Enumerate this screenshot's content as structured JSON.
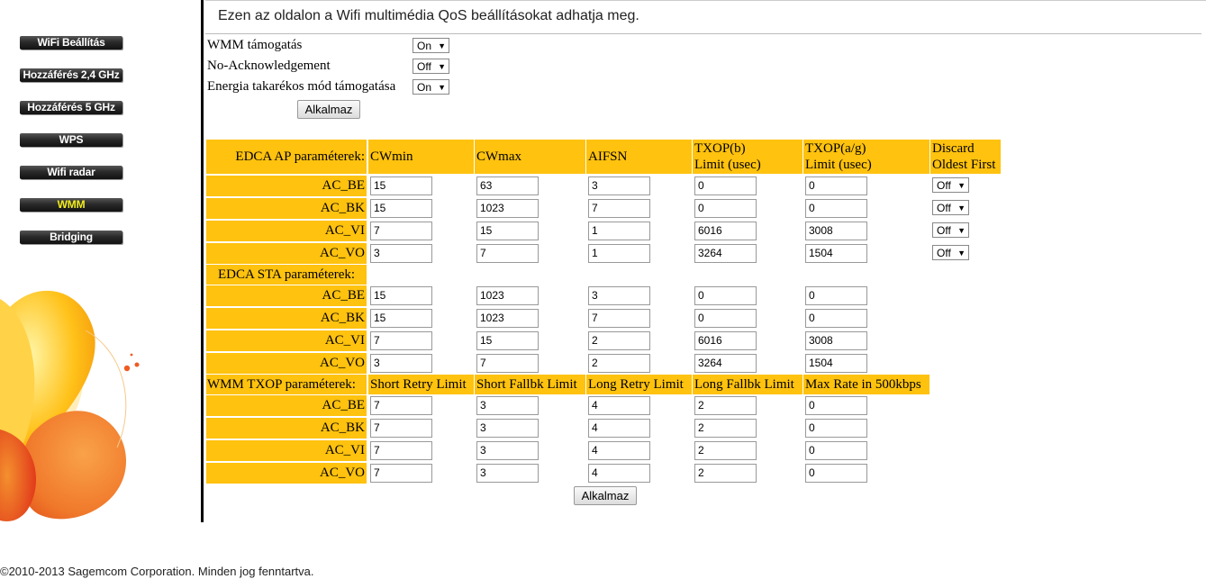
{
  "menu": [
    {
      "label": "WiFi Beállítás",
      "active": false
    },
    {
      "label": "Hozzáférés 2,4 GHz",
      "active": false
    },
    {
      "label": "Hozzáférés 5 GHz",
      "active": false
    },
    {
      "label": "WPS",
      "active": false
    },
    {
      "label": "Wifi radar",
      "active": false
    },
    {
      "label": "WMM",
      "active": true
    },
    {
      "label": "Bridging",
      "active": false
    }
  ],
  "header": "Ezen az oldalon a Wifi multimédia QoS beállításokat adhatja meg.",
  "options": [
    {
      "label": "WMM támogatás",
      "value": "On"
    },
    {
      "label": "No-Acknowledgement",
      "value": "Off"
    },
    {
      "label": "Energia takarékos mód támogatása",
      "value": "On"
    }
  ],
  "apply_label": "Alkalmaz",
  "ap": {
    "section_label": "EDCA AP paraméterek:",
    "headers": [
      "CWmin",
      "CWmax",
      "AIFSN",
      "TXOP(b)\nLimit (usec)",
      "TXOP(a/g)\nLimit (usec)",
      "Discard\nOldest First"
    ],
    "rows": [
      {
        "label": "AC_BE",
        "values": [
          "15",
          "63",
          "3",
          "0",
          "0"
        ],
        "discard": "Off"
      },
      {
        "label": "AC_BK",
        "values": [
          "15",
          "1023",
          "7",
          "0",
          "0"
        ],
        "discard": "Off"
      },
      {
        "label": "AC_VI",
        "values": [
          "7",
          "15",
          "1",
          "6016",
          "3008"
        ],
        "discard": "Off"
      },
      {
        "label": "AC_VO",
        "values": [
          "3",
          "7",
          "1",
          "3264",
          "1504"
        ],
        "discard": "Off"
      }
    ]
  },
  "sta": {
    "section_label": "EDCA STA paraméterek:",
    "rows": [
      {
        "label": "AC_BE",
        "values": [
          "15",
          "1023",
          "3",
          "0",
          "0"
        ]
      },
      {
        "label": "AC_BK",
        "values": [
          "15",
          "1023",
          "7",
          "0",
          "0"
        ]
      },
      {
        "label": "AC_VI",
        "values": [
          "7",
          "15",
          "2",
          "6016",
          "3008"
        ]
      },
      {
        "label": "AC_VO",
        "values": [
          "3",
          "7",
          "2",
          "3264",
          "1504"
        ]
      }
    ]
  },
  "txop": {
    "section_label": "WMM TXOP paraméterek:",
    "headers": [
      "Short Retry Limit",
      "Short Fallbk Limit",
      "Long Retry Limit",
      "Long Fallbk Limit",
      "Max Rate in 500kbps"
    ],
    "rows": [
      {
        "label": "AC_BE",
        "values": [
          "7",
          "3",
          "4",
          "2",
          "0"
        ]
      },
      {
        "label": "AC_BK",
        "values": [
          "7",
          "3",
          "4",
          "2",
          "0"
        ]
      },
      {
        "label": "AC_VI",
        "values": [
          "7",
          "3",
          "4",
          "2",
          "0"
        ]
      },
      {
        "label": "AC_VO",
        "values": [
          "7",
          "3",
          "4",
          "2",
          "0"
        ]
      }
    ]
  },
  "footer": "©2010-2013 Sagemcom Corporation. Minden jog fenntartva.",
  "colors": {
    "header_bg": "#ffc20e",
    "active_menu_text": "#f3ee1a"
  }
}
